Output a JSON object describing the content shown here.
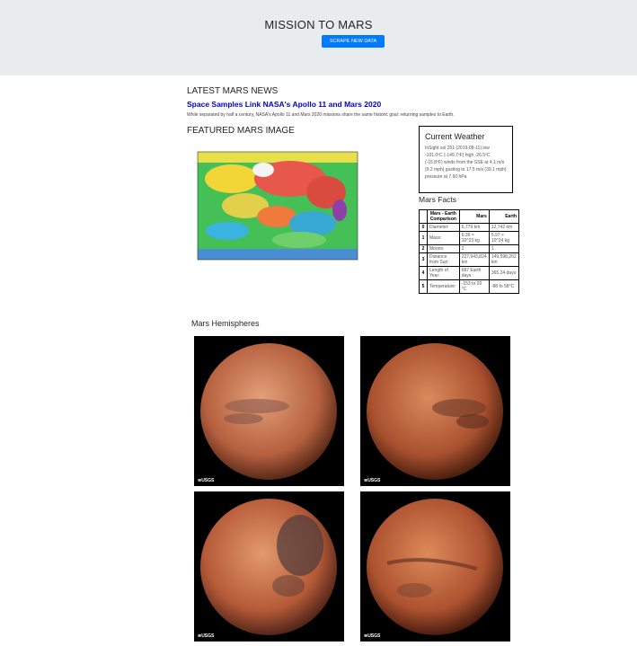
{
  "header": {
    "title": "MISSION TO MARS",
    "scrape_label": "SCRAPE NEW DATA"
  },
  "news": {
    "heading": "LATEST MARS NEWS",
    "title": "Space Samples Link NASA's Apollo 11 and Mars 2020",
    "paragraph": "While separated by half a century, NASA's Apollo 11 and Mars 2020 missions share the same historic goal: returning samples to Earth."
  },
  "featured": {
    "heading": "FEATURED MARS IMAGE"
  },
  "weather": {
    "heading": "Current Weather",
    "text": "InSight sol 251 (2019-08-11) low -101.0ºC (-149.7ºF) high -26.5ºC (-15.8ºF) winds from the SSE at 4.1 m/s (9.2 mph) gusting to 17.5 m/s (39.1 mph) pressure at 7.60 hPa"
  },
  "facts": {
    "heading": "Mars Facts",
    "columns": [
      "Mars - Earth Comparison",
      "Mars",
      "Earth"
    ],
    "rows": [
      {
        "idx": "0",
        "label": "Diameter:",
        "mars": "6,779 km",
        "earth": "12,742 km"
      },
      {
        "idx": "1",
        "label": "Mass:",
        "mars": "6.39 × 10^23 kg",
        "earth": "5.97 × 10^24 kg"
      },
      {
        "idx": "2",
        "label": "Moons:",
        "mars": "2",
        "earth": "1"
      },
      {
        "idx": "3",
        "label": "Distance from Sun:",
        "mars": "227,943,824 km",
        "earth": "149,598,262 km"
      },
      {
        "idx": "4",
        "label": "Length of Year:",
        "mars": "687 Earth days",
        "earth": "365.24 days"
      },
      {
        "idx": "5",
        "label": "Temperature:",
        "mars": "-153 to 20 °C",
        "earth": "-88 to 58°C"
      }
    ]
  },
  "hemispheres": {
    "heading": "Mars Hemispheres",
    "logo": "≋USGS"
  },
  "colors": {
    "jumbotron": "#e9ecef",
    "button": "#007bff",
    "news_link": "#0000cc"
  }
}
